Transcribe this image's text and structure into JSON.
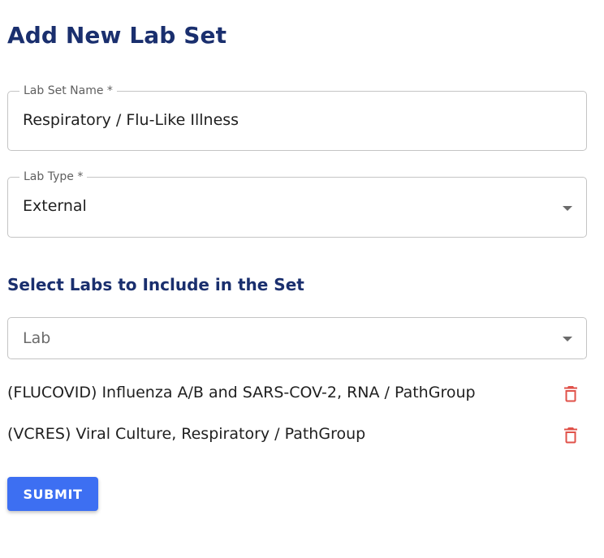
{
  "page": {
    "title": "Add New Lab Set"
  },
  "form": {
    "lab_set_name": {
      "label": "Lab Set Name *",
      "value": "Respiratory / Flu-Like Illness"
    },
    "lab_type": {
      "label": "Lab Type *",
      "value": "External"
    }
  },
  "labs_section": {
    "title": "Select Labs to Include in the Set",
    "lab_select": {
      "placeholder": "Lab"
    },
    "selected_labs": [
      {
        "label": "(FLUCOVID) Influenza A/B and SARS-COV-2, RNA / PathGroup",
        "delete_icon": "trash-icon"
      },
      {
        "label": "(VCRES) Viral Culture, Respiratory / PathGroup",
        "delete_icon": "trash-icon"
      }
    ]
  },
  "actions": {
    "submit_label": "SUBMIT"
  },
  "colors": {
    "heading": "#1a2f6e",
    "primary_button": "#3d6ff2",
    "delete_icon": "#e0524a",
    "border": "#c4c4c4"
  }
}
